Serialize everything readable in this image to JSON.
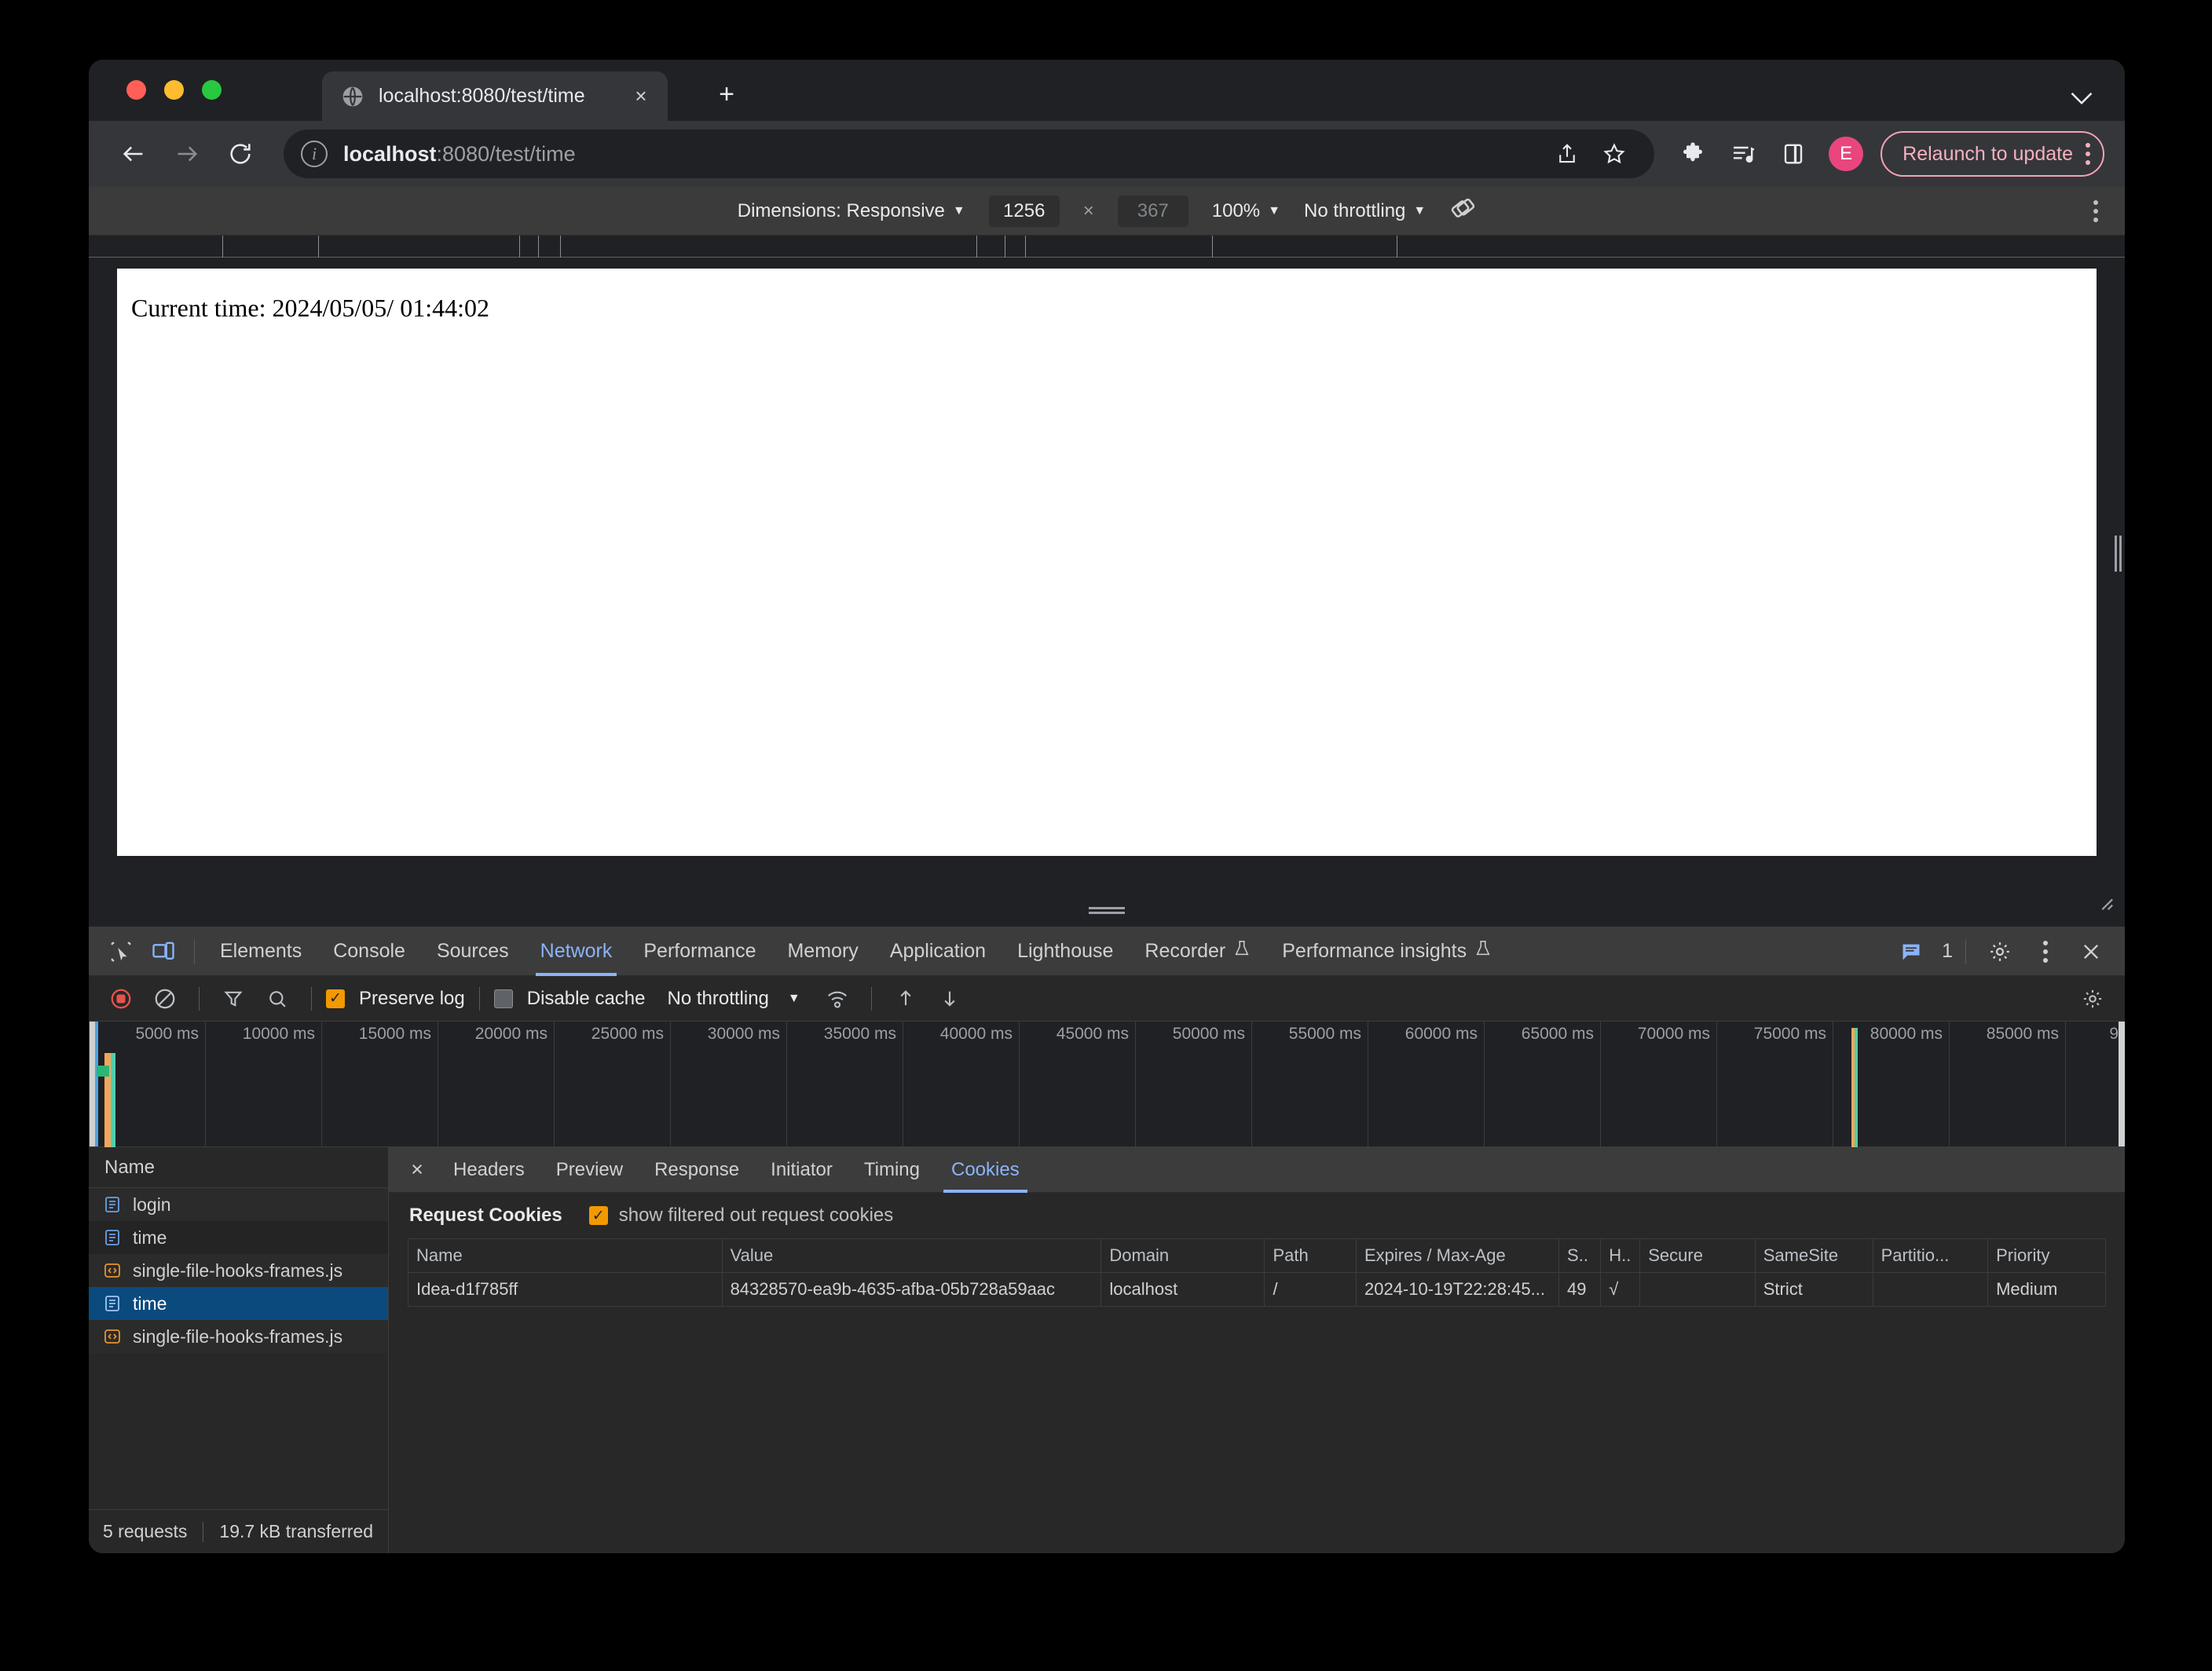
{
  "browser": {
    "tab": {
      "title": "localhost:8080/test/time",
      "favicon": "globe-icon",
      "close": "×"
    },
    "newtab_label": "+",
    "tabstrip_chevron": "⌄",
    "omnibox": {
      "host": "localhost",
      "rest": ":8080/test/time",
      "info_icon": "info-icon"
    },
    "nav": {
      "back": "←",
      "forward": "→",
      "reload": "↻"
    },
    "actions": {
      "share": "share-icon",
      "bookmark": "star-icon",
      "extensions": "puzzle-icon",
      "reading_list": "reading-list-icon",
      "side_panel": "side-panel-icon",
      "profile_initial": "E",
      "relaunch_label": "Relaunch to update",
      "menu": "kebab-menu-icon"
    }
  },
  "device_toolbar": {
    "dimensions_label": "Dimensions: Responsive",
    "width": "1256",
    "times": "×",
    "height": "367",
    "zoom": "100%",
    "throttling": "No throttling",
    "rotate_icon": "rotate-icon",
    "menu": "kebab-menu-icon"
  },
  "page": {
    "content": "Current time: 2024/05/05/ 01:44:02"
  },
  "devtools": {
    "tools": {
      "inspect": "inspect-icon",
      "device": "device-toolbar-icon"
    },
    "tabs": [
      {
        "label": "Elements",
        "active": false,
        "experimental": false
      },
      {
        "label": "Console",
        "active": false,
        "experimental": false
      },
      {
        "label": "Sources",
        "active": false,
        "experimental": false
      },
      {
        "label": "Network",
        "active": true,
        "experimental": false
      },
      {
        "label": "Performance",
        "active": false,
        "experimental": false
      },
      {
        "label": "Memory",
        "active": false,
        "experimental": false
      },
      {
        "label": "Application",
        "active": false,
        "experimental": false
      },
      {
        "label": "Lighthouse",
        "active": false,
        "experimental": false
      },
      {
        "label": "Recorder",
        "active": false,
        "experimental": true
      },
      {
        "label": "Performance insights",
        "active": false,
        "experimental": true
      }
    ],
    "right": {
      "message_icon": "message-icon",
      "message_count": "1",
      "settings_icon": "gear-icon",
      "more_icon": "kebab-menu-icon",
      "close_icon": "close-icon"
    },
    "network_toolbar": {
      "record": "record-icon",
      "clear": "clear-icon",
      "filter": "filter-icon",
      "search": "search-icon",
      "preserve_log_label": "Preserve log",
      "preserve_log_checked": true,
      "disable_cache_label": "Disable cache",
      "disable_cache_checked": false,
      "throttling": "No throttling",
      "wifi_icon": "network-conditions-icon",
      "import_icon": "import-har-icon",
      "export_icon": "export-har-icon",
      "settings_icon": "gear-icon"
    },
    "overview_ticks": [
      "5000 ms",
      "10000 ms",
      "15000 ms",
      "20000 ms",
      "25000 ms",
      "30000 ms",
      "35000 ms",
      "40000 ms",
      "45000 ms",
      "50000 ms",
      "55000 ms",
      "60000 ms",
      "65000 ms",
      "70000 ms",
      "75000 ms",
      "80000 ms",
      "85000 ms",
      "9"
    ],
    "request_list": {
      "header": "Name",
      "rows": [
        {
          "name": "login",
          "icon": "document-icon",
          "selected": false
        },
        {
          "name": "time",
          "icon": "document-icon",
          "selected": false
        },
        {
          "name": "single-file-hooks-frames.js",
          "icon": "script-icon",
          "selected": false
        },
        {
          "name": "time",
          "icon": "document-icon",
          "selected": true
        },
        {
          "name": "single-file-hooks-frames.js",
          "icon": "script-icon",
          "selected": false
        }
      ],
      "status_requests": "5 requests",
      "status_transferred": "19.7 kB transferred"
    },
    "detail": {
      "close": "×",
      "tabs": [
        {
          "label": "Headers",
          "active": false
        },
        {
          "label": "Preview",
          "active": false
        },
        {
          "label": "Response",
          "active": false
        },
        {
          "label": "Initiator",
          "active": false
        },
        {
          "label": "Timing",
          "active": false
        },
        {
          "label": "Cookies",
          "active": true
        }
      ],
      "cookies": {
        "section_title": "Request Cookies",
        "filter_label": "show filtered out request cookies",
        "filter_checked": true,
        "columns": [
          "Name",
          "Value",
          "Domain",
          "Path",
          "Expires / Max-Age",
          "S..",
          "H..",
          "Secure",
          "SameSite",
          "Partitio...",
          "Priority"
        ],
        "rows": [
          {
            "name": "Idea-d1f785ff",
            "value": "84328570-ea9b-4635-afba-05b728a59aac",
            "domain": "localhost",
            "path": "/",
            "expires": "2024-10-19T22:28:45...",
            "size": "49",
            "httponly": "√",
            "secure": "",
            "samesite": "Strict",
            "partition": "",
            "priority": "Medium"
          }
        ]
      }
    }
  }
}
